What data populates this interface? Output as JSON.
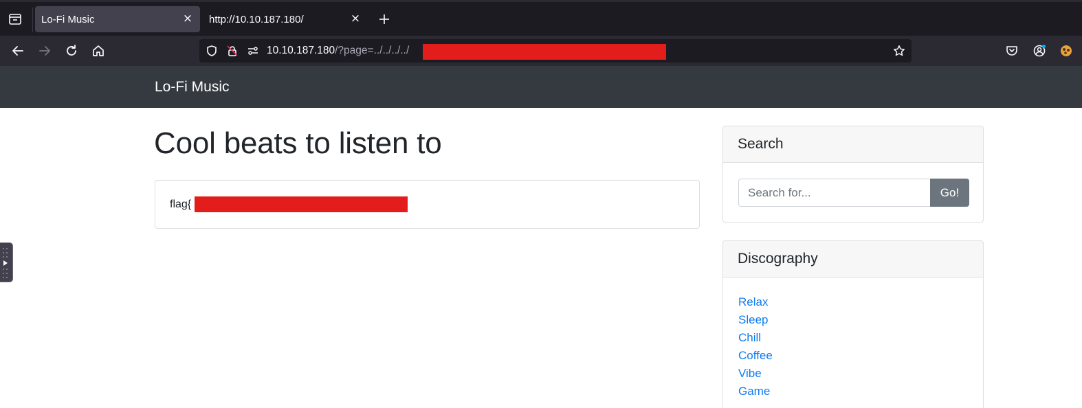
{
  "browser": {
    "tabs": [
      {
        "title": "Lo-Fi Music",
        "active": true
      },
      {
        "title": "http://10.10.187.180/",
        "active": false
      }
    ],
    "url": {
      "host": "10.10.187.180",
      "path": "/?page=../../../../"
    }
  },
  "site": {
    "brand": "Lo-Fi Music",
    "title": "Cool beats to listen to",
    "flag_prefix": "flag{",
    "flag_suffix": "}"
  },
  "search": {
    "header": "Search",
    "placeholder": "Search for...",
    "button": "Go!"
  },
  "discography": {
    "header": "Discography",
    "items": [
      "Relax",
      "Sleep",
      "Chill",
      "Coffee",
      "Vibe",
      "Game"
    ]
  },
  "colors": {
    "chrome_dark": "#1c1b22",
    "chrome_mid": "#2b2a33",
    "site_nav": "#343a40",
    "link": "#0d7bf2",
    "redaction": "#e31c1c"
  }
}
